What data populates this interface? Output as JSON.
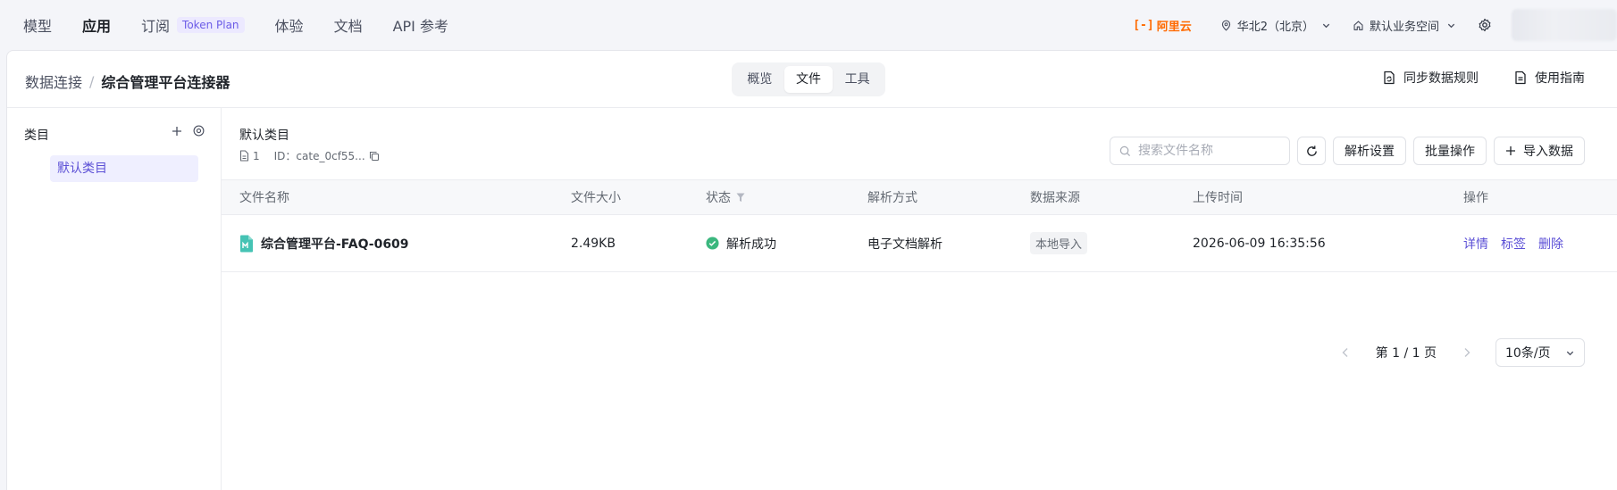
{
  "topnav": {
    "items": [
      {
        "label": "模型"
      },
      {
        "label": "应用"
      },
      {
        "label": "订阅",
        "badge": "Token Plan"
      },
      {
        "label": "体验"
      },
      {
        "label": "文档"
      },
      {
        "label": "API 参考"
      }
    ],
    "brand": {
      "mark": "[-]",
      "name": "阿里云",
      "color": "#ff6a00"
    },
    "region": "华北2（北京）",
    "workspace": "默认业务空间"
  },
  "header": {
    "breadcrumb_root": "数据连接",
    "breadcrumb_separator": "/",
    "title": "综合管理平台连接器",
    "tabs": [
      {
        "label": "概览"
      },
      {
        "label": "文件"
      },
      {
        "label": "工具"
      }
    ],
    "sync_rules": "同步数据规则",
    "guide": "使用指南"
  },
  "sidebar": {
    "title": "类目",
    "categories": [
      {
        "label": "默认类目"
      }
    ]
  },
  "category": {
    "title": "默认类目",
    "doc_count": "1",
    "id_label": "ID：cate_0cf55..."
  },
  "toolbar": {
    "search_placeholder": "搜索文件名称",
    "parse_settings": "解析设置",
    "batch_ops": "批量操作",
    "import_data": "导入数据"
  },
  "table": {
    "columns": [
      "文件名称",
      "文件大小",
      "状态",
      "解析方式",
      "数据来源",
      "上传时间",
      "操作"
    ],
    "rows": [
      {
        "name": "综合管理平台-FAQ-0609",
        "size": "2.49KB",
        "status": "解析成功",
        "parse_method": "电子文档解析",
        "source": "本地导入",
        "upload_time": "2026-06-09 16:35:56",
        "ops": [
          "详情",
          "标签",
          "删除"
        ]
      }
    ]
  },
  "pagination": {
    "page_text": "第 1 / 1 页",
    "page_size": "10条/页"
  },
  "colors": {
    "accent": "#5b4fd6",
    "success": "#3bb77e",
    "brand": "#ff6a00"
  }
}
